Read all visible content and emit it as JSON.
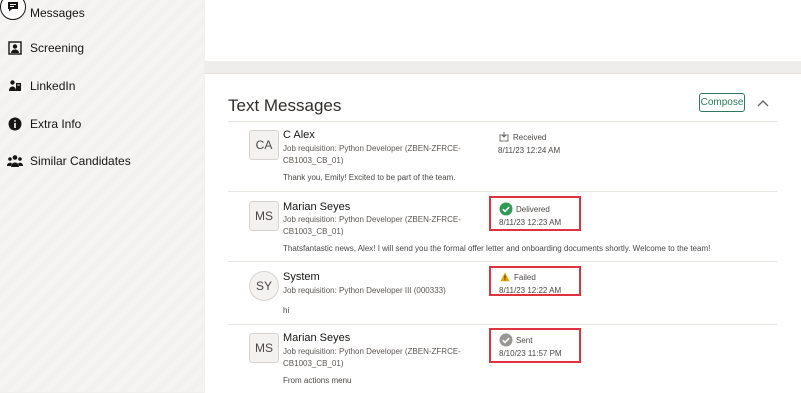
{
  "sidebar": {
    "items": [
      {
        "label": "Messages",
        "icon": "message-icon"
      },
      {
        "label": "Screening",
        "icon": "screening-icon"
      },
      {
        "label": "LinkedIn",
        "icon": "linkedin-icon"
      },
      {
        "label": "Extra Info",
        "icon": "info-icon"
      },
      {
        "label": "Similar Candidates",
        "icon": "people-icon"
      }
    ]
  },
  "panel": {
    "title": "Text Messages",
    "compose_label": "Compose"
  },
  "messages": [
    {
      "initials": "CA",
      "sender": "C Alex",
      "requisition": "Job requisition: Python Developer (ZBEN-ZFRCE-CB1003_CB_01)",
      "body": "Thank you, Emily! Excited to be part of the team.",
      "status": "Received",
      "timestamp": "8/11/23 12:24 AM"
    },
    {
      "initials": "MS",
      "sender": "Marian Seyes",
      "requisition": "Job requisition: Python Developer (ZBEN-ZFRCE-CB1003_CB_01)",
      "body": "Thatsfantastic news, Alex! I will send you the formal offer letter and onboarding documents shortly. Welcome to the team!",
      "status": "Delivered",
      "timestamp": "8/11/23 12:23 AM"
    },
    {
      "initials": "SY",
      "sender": "System",
      "requisition": "Job requisition: Python Developer III (000333)",
      "body": "hi",
      "status": "Failed",
      "timestamp": "8/11/23 12:22 AM"
    },
    {
      "initials": "MS",
      "sender": "Marian Seyes",
      "requisition": "Job requisition: Python Developer (ZBEN-ZFRCE-CB1003_CB_01)",
      "body": "From actions menu",
      "status": "Sent",
      "timestamp": "8/10/23 11:57 PM"
    }
  ],
  "colors": {
    "delivered": "#2e9c52",
    "failed": "#e5a500",
    "sent": "#9a9692",
    "highlight": "#e0333b",
    "compose": "#2c7a5b"
  }
}
